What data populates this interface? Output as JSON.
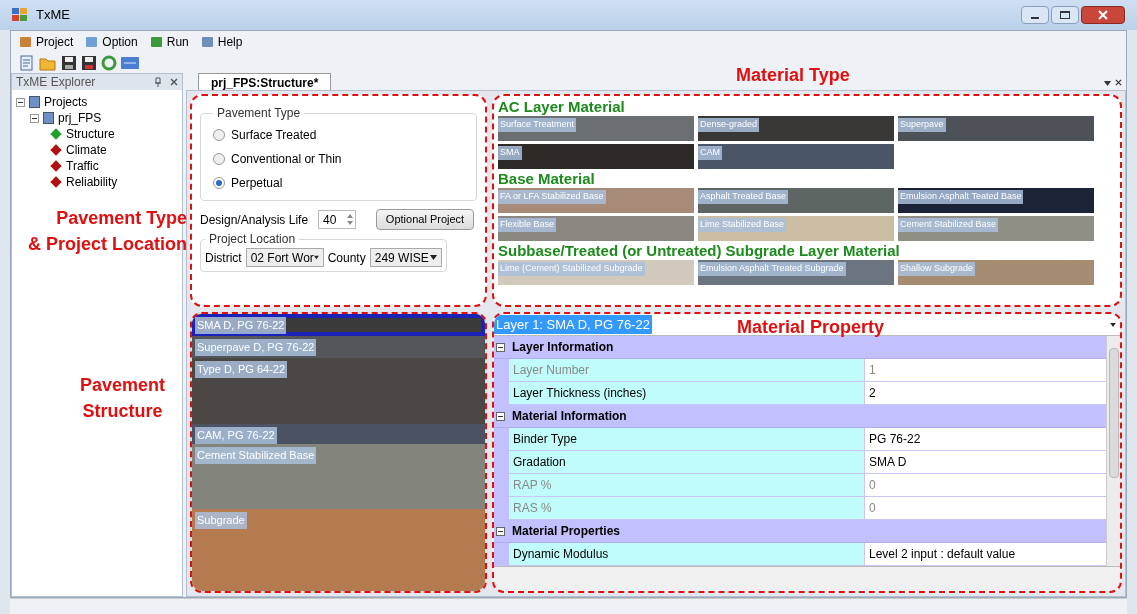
{
  "window": {
    "title": "TxME"
  },
  "menu": [
    {
      "label": "Project"
    },
    {
      "label": "Option"
    },
    {
      "label": "Run"
    },
    {
      "label": "Help"
    }
  ],
  "explorer": {
    "title": "TxME Explorer",
    "tree": [
      {
        "label": "Projects",
        "expanded": true,
        "children": [
          {
            "label": "prj_FPS",
            "expanded": true,
            "children": [
              {
                "label": "Structure",
                "color": "#1fa02a"
              },
              {
                "label": "Climate",
                "color": "#b01010"
              },
              {
                "label": "Traffic",
                "color": "#b01010"
              },
              {
                "label": "Reliability",
                "color": "#b01010"
              }
            ]
          }
        ]
      }
    ]
  },
  "tabs": [
    {
      "label": "prj_FPS:Structure*",
      "selected": true
    }
  ],
  "pavement_type": {
    "title": "Pavement Type",
    "options": [
      {
        "label": "Surface Treated",
        "selected": false
      },
      {
        "label": "Conventional or Thin",
        "selected": false
      },
      {
        "label": "Perpetual",
        "selected": true
      }
    ],
    "design_life_label": "Design/Analysis Life",
    "design_life": "40",
    "optional_button": "Optional Project",
    "location_title": "Project Location",
    "district_label": "District",
    "district": "02 Fort Wor",
    "county_label": "County",
    "county": "249 WISE"
  },
  "material_groups": [
    {
      "title": "AC Layer Material",
      "tiles": [
        {
          "label": "Surface Treatment",
          "color": "#6b6f72"
        },
        {
          "label": "Dense-graded",
          "color": "#3a3836"
        },
        {
          "label": "Superpave",
          "color": "#4d5258"
        },
        {
          "label": "SMA",
          "color": "#2e2a27"
        },
        {
          "label": "CAM",
          "color": "#4a5568"
        }
      ]
    },
    {
      "title": "Base Material",
      "tiles": [
        {
          "label": "FA or LFA Stabilized Base",
          "color": "#a88a78"
        },
        {
          "label": "Asphalt Treated Base",
          "color": "#5d6663"
        },
        {
          "label": "Emulsion Asphalt Teated Base",
          "color": "#1c2336"
        },
        {
          "label": "Flexible Base",
          "color": "#8a8780"
        },
        {
          "label": "Lime Stabilized Base",
          "color": "#cbbda4"
        },
        {
          "label": "Cement Stabilized Base",
          "color": "#8f8f86"
        }
      ]
    },
    {
      "title": "Subbase/Treated (or Untreated) Subgrade Layer Material",
      "tiles": [
        {
          "label": "Lime (Cement) Stabilized Subgrade",
          "color": "#d2c9bd"
        },
        {
          "label": "Emulsion Asphalt Treated Subgrade",
          "color": "#6c7480"
        },
        {
          "label": "Shallow Subgrade",
          "color": "#a58c70"
        }
      ]
    }
  ],
  "layers": [
    {
      "label": "SMA D, PG 76-22",
      "color": "#3a3a3a",
      "selected": true
    },
    {
      "label": "Superpave D, PG 76-22",
      "color": "#55565a",
      "selected": false
    },
    {
      "label": "Type D, PG 64-22",
      "color": "#4a4744",
      "selected": false
    },
    {
      "label": "CAM, PG 76-22",
      "color": "#4b5363",
      "selected": false
    },
    {
      "label": "Cement Stabilized Base",
      "color": "#83857c",
      "selected": false
    },
    {
      "label": "Subgrade",
      "color": "#b47a50",
      "selected": false
    }
  ],
  "property_grid": {
    "selector": "Layer 1: SMA D, PG 76-22",
    "rows": [
      {
        "kind": "section",
        "label": "Layer Information",
        "expanded": true
      },
      {
        "kind": "property",
        "label": "Layer Number",
        "value": "1",
        "disabled": true
      },
      {
        "kind": "property",
        "label": "Layer Thickness (inches)",
        "value": "2",
        "disabled": false
      },
      {
        "kind": "section",
        "label": "Material Information",
        "expanded": true
      },
      {
        "kind": "property",
        "label": "Binder Type",
        "value": "PG 76-22",
        "disabled": false
      },
      {
        "kind": "property",
        "label": "Gradation",
        "value": "SMA D",
        "disabled": false
      },
      {
        "kind": "property",
        "label": "RAP %",
        "value": "0",
        "disabled": true
      },
      {
        "kind": "property",
        "label": "RAS %",
        "value": "0",
        "disabled": true
      },
      {
        "kind": "section",
        "label": "Material Properties",
        "expanded": true
      },
      {
        "kind": "property",
        "label": "Dynamic Modulus",
        "value": "Level 2 input : default value",
        "disabled": false
      }
    ]
  },
  "annotations": [
    {
      "kind": "material_type",
      "label": "Material Type"
    },
    {
      "kind": "pavement_type",
      "label": "Pavement Type\n& Project Location"
    },
    {
      "kind": "structure",
      "label": "Pavement\nStructure"
    },
    {
      "kind": "property",
      "label": "Material Property"
    }
  ]
}
